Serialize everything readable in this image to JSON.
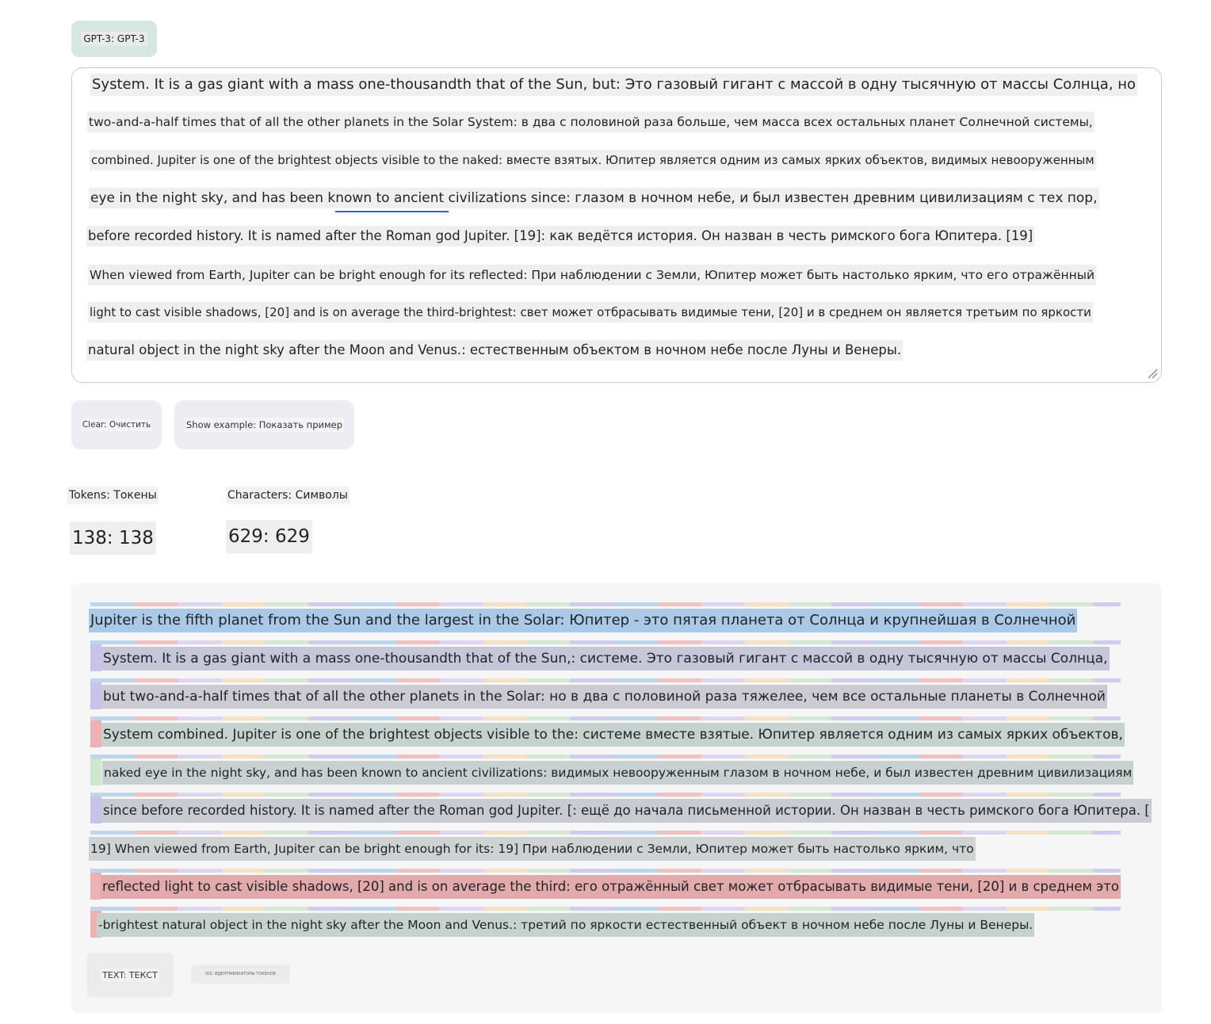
{
  "model": {
    "label": "GPT-3: GPT-3"
  },
  "input_text_lines": [
    "System. It is a gas giant with a mass one-thousandth that of the Sun, but: Это газовый гигант с массой в одну тысячную от массы Солнца, но",
    "two-and-a-half times that of all the other planets in the Solar System: в два с половиной раза больше, чем масса всех остальных планет Солнечной системы,",
    "combined. Jupiter is one of the brightest objects visible to the naked: вместе взятых. Юпитер является одним из самых ярких объектов, видимых невооруженным",
    "eye in the night sky, and has been known to ancient civilizations since: глазом в ночном небе, и был известен древним цивилизациям с тех пор,",
    "before recorded history. It is named after the Roman god Jupiter. [19]: как ведётся история. Он назван в честь римского бога Юпитера. [19]",
    "When viewed from Earth, Jupiter can be bright enough for its reflected: При наблюдении с Земли, Юпитер может быть настолько ярким, что его отражённый",
    "light to cast visible shadows, [20] and is on average the third-brightest: свет может отбрасывать видимые тени, [20] и в среднем он является третьим по яркости",
    "natural object in the night sky after the Moon and Venus.: естественным объектом в ночном небе после Луны и Венеры."
  ],
  "buttons": {
    "clear": "Clear: Очистить",
    "show_example": "Show example: Показать пример"
  },
  "stats": {
    "tokens_label": "Tokens: Токены",
    "tokens_value": "138: 138",
    "characters_label": "Characters: Символы",
    "characters_value": "629: 629"
  },
  "output_lines": [
    {
      "text": "Jupiter is the fifth planet from the Sun and the largest in the Solar: Юпитер - это пятая планета от Солнца и крупнейшая в Солнечной",
      "color": "#a9c9e6",
      "chip": ""
    },
    {
      "text": "System. It is a gas giant with a mass one-thousandth that of the Sun,: системе. Это газовый гигант с массой в одну тысячную от массы Солнца,",
      "color": "#c5c6d8",
      "chip": "#c9c2ea"
    },
    {
      "text": "but two-and-a-half times that of all the other planets in the Solar: но в два с половиной раза тяжелее, чем все остальные планеты в Солнечной",
      "color": "#cccbd3",
      "chip": "#c9c2ea"
    },
    {
      "text": "System combined. Jupiter is one of the brightest objects visible to the: системе вместе взятые. Юпитер является одним из самых ярких объектов,",
      "color": "#c6d2cd",
      "chip": "#eeb2b2"
    },
    {
      "text": "naked eye in the night sky, and has been known to ancient civilizations: видимых невооруженным глазом в ночном небе, и был известен древним цивилизациям",
      "color": "#c8d1cf",
      "chip": "#cde8cd"
    },
    {
      "text": "since before recorded history. It is named after the Roman god Jupiter. [: ещё до начала письменной истории. Он назван в честь римского бога Юпитера. [",
      "color": "#c8ccd2",
      "chip": "#c9c2ea"
    },
    {
      "text": "19] When viewed from Earth, Jupiter can be bright enough for its: 19] При наблюдении с Земли, Юпитер может быть настолько ярким, что",
      "color": "#ccd3d2",
      "chip": ""
    },
    {
      "text": "reflected light to cast visible shadows, [20] and is on average the third: его отражённый свет может отбрасывать видимые тени, [20] и в среднем это",
      "color": "#e2aaaa",
      "chip": "#eeb2b2"
    },
    {
      "text": "-brightest natural object in the night sky after the Moon and Venus.: третий по яркости естественный объект в ночном небе после Луны и Венеры.",
      "color": "#c6d2cd",
      "chip": "#eeb2b2"
    }
  ],
  "view_toggle": {
    "text_label": "TEXT: ТЕКСТ",
    "ids_label": "IDS: ИДЕНТИФИКАТОРЫ ТОКЕНОВ"
  }
}
